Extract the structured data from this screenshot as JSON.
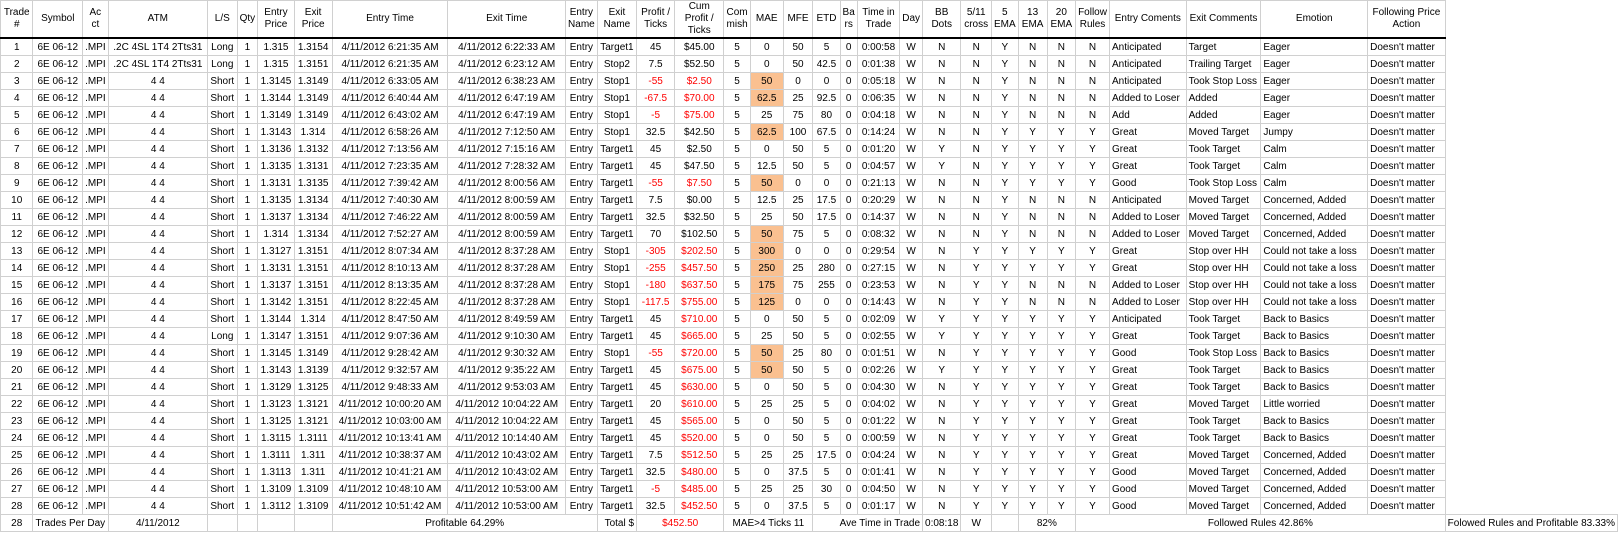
{
  "headers": [
    "Trade #",
    "Symbol",
    "Ac ct",
    "ATM",
    "L/S",
    "Qty",
    "Entry Price",
    "Exit Price",
    "Entry Time",
    "Exit Time",
    "Entry Name",
    "Exit Name",
    "Profit / Ticks",
    "Cum Profit / Ticks",
    "Com mish",
    "MAE",
    "MFE",
    "ETD",
    "Ba rs",
    "Time in Trade",
    "Day",
    "BB Dots",
    "5/11 cross",
    "5 EMA",
    "13 EMA",
    "20 EMA",
    "Follow Rules",
    "Entry Coments",
    "Exit Comments",
    "Emotion",
    "Following Price Action"
  ],
  "rows": [
    [
      "1",
      "6E 06-12",
      ".MPI",
      ".2C 4SL 1T4 2Tts31",
      "Long",
      "1",
      "1.315",
      "1.3154",
      "4/11/2012 6:21:35 AM",
      "4/11/2012 6:22:33 AM",
      "Entry",
      "Target1",
      "45",
      "$45.00",
      "5",
      "0",
      "50",
      "5",
      "0",
      "0:00:58",
      "W",
      "N",
      "N",
      "Y",
      "N",
      "N",
      "N",
      "Anticipated",
      "Target",
      "Eager",
      "Doesn't matter"
    ],
    [
      "2",
      "6E 06-12",
      ".MPI",
      ".2C 4SL 1T4 2Tts31",
      "Long",
      "1",
      "1.315",
      "1.3151",
      "4/11/2012 6:21:35 AM",
      "4/11/2012 6:23:12 AM",
      "Entry",
      "Stop2",
      "7.5",
      "$52.50",
      "5",
      "0",
      "50",
      "42.5",
      "0",
      "0:01:38",
      "W",
      "N",
      "N",
      "Y",
      "N",
      "N",
      "N",
      "Anticipated",
      "Trailing Target",
      "Eager",
      "Doesn't matter"
    ],
    [
      "3",
      "6E 06-12",
      ".MPI",
      "4 4",
      "Short",
      "1",
      "1.3145",
      "1.3149",
      "4/11/2012 6:33:05 AM",
      "4/11/2012 6:38:23 AM",
      "Entry",
      "Stop1",
      "-55",
      "$2.50",
      "5",
      "50",
      "0",
      "0",
      "0",
      "0:05:18",
      "W",
      "N",
      "N",
      "Y",
      "N",
      "N",
      "N",
      "Anticipated",
      "Took Stop Loss",
      "Eager",
      "Doesn't matter"
    ],
    [
      "4",
      "6E 06-12",
      ".MPI",
      "4 4",
      "Short",
      "1",
      "1.3144",
      "1.3149",
      "4/11/2012 6:40:44 AM",
      "4/11/2012 6:47:19 AM",
      "Entry",
      "Stop1",
      "-67.5",
      "$70.00",
      "5",
      "62.5",
      "25",
      "92.5",
      "0",
      "0:06:35",
      "W",
      "N",
      "N",
      "Y",
      "N",
      "N",
      "N",
      "Added to Loser",
      "Added",
      "Eager",
      "Doesn't matter"
    ],
    [
      "5",
      "6E 06-12",
      ".MPI",
      "4 4",
      "Short",
      "1",
      "1.3149",
      "1.3149",
      "4/11/2012 6:43:02 AM",
      "4/11/2012 6:47:19 AM",
      "Entry",
      "Stop1",
      "-5",
      "$75.00",
      "5",
      "25",
      "75",
      "80",
      "0",
      "0:04:18",
      "W",
      "N",
      "N",
      "Y",
      "N",
      "N",
      "N",
      "Add",
      "Added",
      "Eager",
      "Doesn't matter"
    ],
    [
      "6",
      "6E 06-12",
      ".MPI",
      "4 4",
      "Short",
      "1",
      "1.3143",
      "1.314",
      "4/11/2012 6:58:26 AM",
      "4/11/2012 7:12:50 AM",
      "Entry",
      "Stop1",
      "32.5",
      "$42.50",
      "5",
      "62.5",
      "100",
      "67.5",
      "0",
      "0:14:24",
      "W",
      "N",
      "N",
      "Y",
      "Y",
      "Y",
      "Y",
      "Great",
      "Moved Target",
      "Jumpy",
      "Doesn't matter"
    ],
    [
      "7",
      "6E 06-12",
      ".MPI",
      "4 4",
      "Short",
      "1",
      "1.3136",
      "1.3132",
      "4/11/2012 7:13:56 AM",
      "4/11/2012 7:15:16 AM",
      "Entry",
      "Target1",
      "45",
      "$2.50",
      "5",
      "0",
      "50",
      "5",
      "0",
      "0:01:20",
      "W",
      "Y",
      "N",
      "Y",
      "Y",
      "Y",
      "Y",
      "Great",
      "Took Target",
      "Calm",
      "Doesn't matter"
    ],
    [
      "8",
      "6E 06-12",
      ".MPI",
      "4 4",
      "Short",
      "1",
      "1.3135",
      "1.3131",
      "4/11/2012 7:23:35 AM",
      "4/11/2012 7:28:32 AM",
      "Entry",
      "Target1",
      "45",
      "$47.50",
      "5",
      "12.5",
      "50",
      "5",
      "0",
      "0:04:57",
      "W",
      "Y",
      "N",
      "Y",
      "Y",
      "Y",
      "Y",
      "Great",
      "Took Target",
      "Calm",
      "Doesn't matter"
    ],
    [
      "9",
      "6E 06-12",
      ".MPI",
      "4 4",
      "Short",
      "1",
      "1.3131",
      "1.3135",
      "4/11/2012 7:39:42 AM",
      "4/11/2012 8:00:56 AM",
      "Entry",
      "Target1",
      "-55",
      "$7.50",
      "5",
      "50",
      "0",
      "0",
      "0",
      "0:21:13",
      "W",
      "N",
      "N",
      "Y",
      "Y",
      "Y",
      "Y",
      "Good",
      "Took Stop Loss",
      "Calm",
      "Doesn't matter"
    ],
    [
      "10",
      "6E 06-12",
      ".MPI",
      "4 4",
      "Short",
      "1",
      "1.3135",
      "1.3134",
      "4/11/2012 7:40:30 AM",
      "4/11/2012 8:00:59 AM",
      "Entry",
      "Target1",
      "7.5",
      "$0.00",
      "5",
      "12.5",
      "25",
      "17.5",
      "0",
      "0:20:29",
      "W",
      "N",
      "N",
      "Y",
      "N",
      "N",
      "N",
      "Anticipated",
      "Moved Target",
      "Concerned, Added",
      "Doesn't matter"
    ],
    [
      "11",
      "6E 06-12",
      ".MPI",
      "4 4",
      "Short",
      "1",
      "1.3137",
      "1.3134",
      "4/11/2012 7:46:22 AM",
      "4/11/2012 8:00:59 AM",
      "Entry",
      "Target1",
      "32.5",
      "$32.50",
      "5",
      "25",
      "50",
      "17.5",
      "0",
      "0:14:37",
      "W",
      "N",
      "N",
      "Y",
      "N",
      "N",
      "N",
      "Added to Loser",
      "Moved Target",
      "Concerned, Added",
      "Doesn't matter"
    ],
    [
      "12",
      "6E 06-12",
      ".MPI",
      "4 4",
      "Short",
      "1",
      "1.314",
      "1.3134",
      "4/11/2012 7:52:27 AM",
      "4/11/2012 8:00:59 AM",
      "Entry",
      "Target1",
      "70",
      "$102.50",
      "5",
      "50",
      "75",
      "5",
      "0",
      "0:08:32",
      "W",
      "N",
      "N",
      "Y",
      "N",
      "N",
      "N",
      "Added to Loser",
      "Moved Target",
      "Concerned, Added",
      "Doesn't matter"
    ],
    [
      "13",
      "6E 06-12",
      ".MPI",
      "4 4",
      "Short",
      "1",
      "1.3127",
      "1.3151",
      "4/11/2012 8:07:34 AM",
      "4/11/2012 8:37:28 AM",
      "Entry",
      "Stop1",
      "-305",
      "$202.50",
      "5",
      "300",
      "0",
      "0",
      "0",
      "0:29:54",
      "W",
      "N",
      "Y",
      "Y",
      "Y",
      "Y",
      "Y",
      "Great",
      "Stop over HH",
      "Could not take a loss",
      "Doesn't matter"
    ],
    [
      "14",
      "6E 06-12",
      ".MPI",
      "4 4",
      "Short",
      "1",
      "1.3131",
      "1.3151",
      "4/11/2012 8:10:13 AM",
      "4/11/2012 8:37:28 AM",
      "Entry",
      "Stop1",
      "-255",
      "$457.50",
      "5",
      "250",
      "25",
      "280",
      "0",
      "0:27:15",
      "W",
      "N",
      "Y",
      "Y",
      "Y",
      "Y",
      "Y",
      "Great",
      "Stop over HH",
      "Could not take a loss",
      "Doesn't matter"
    ],
    [
      "15",
      "6E 06-12",
      ".MPI",
      "4 4",
      "Short",
      "1",
      "1.3137",
      "1.3151",
      "4/11/2012 8:13:35 AM",
      "4/11/2012 8:37:28 AM",
      "Entry",
      "Stop1",
      "-180",
      "$637.50",
      "5",
      "175",
      "75",
      "255",
      "0",
      "0:23:53",
      "W",
      "N",
      "Y",
      "Y",
      "N",
      "N",
      "N",
      "Added to Loser",
      "Stop over HH",
      "Could not take a loss",
      "Doesn't matter"
    ],
    [
      "16",
      "6E 06-12",
      ".MPI",
      "4 4",
      "Short",
      "1",
      "1.3142",
      "1.3151",
      "4/11/2012 8:22:45 AM",
      "4/11/2012 8:37:28 AM",
      "Entry",
      "Stop1",
      "-117.5",
      "$755.00",
      "5",
      "125",
      "0",
      "0",
      "0",
      "0:14:43",
      "W",
      "N",
      "Y",
      "Y",
      "N",
      "N",
      "N",
      "Added to Loser",
      "Stop over HH",
      "Could not take a loss",
      "Doesn't matter"
    ],
    [
      "17",
      "6E 06-12",
      ".MPI",
      "4 4",
      "Short",
      "1",
      "1.3144",
      "1.314",
      "4/11/2012 8:47:50 AM",
      "4/11/2012 8:49:59 AM",
      "Entry",
      "Target1",
      "45",
      "$710.00",
      "5",
      "0",
      "50",
      "5",
      "0",
      "0:02:09",
      "W",
      "Y",
      "Y",
      "Y",
      "Y",
      "Y",
      "Y",
      "Anticipated",
      "Took Target",
      "Back to Basics",
      "Doesn't matter"
    ],
    [
      "18",
      "6E 06-12",
      ".MPI",
      "4 4",
      "Long",
      "1",
      "1.3147",
      "1.3151",
      "4/11/2012 9:07:36 AM",
      "4/11/2012 9:10:30 AM",
      "Entry",
      "Target1",
      "45",
      "$665.00",
      "5",
      "25",
      "50",
      "5",
      "0",
      "0:02:55",
      "W",
      "Y",
      "Y",
      "Y",
      "Y",
      "Y",
      "Y",
      "Great",
      "Took Target",
      "Back to Basics",
      "Doesn't matter"
    ],
    [
      "19",
      "6E 06-12",
      ".MPI",
      "4 4",
      "Short",
      "1",
      "1.3145",
      "1.3149",
      "4/11/2012 9:28:42 AM",
      "4/11/2012 9:30:32 AM",
      "Entry",
      "Stop1",
      "-55",
      "$720.00",
      "5",
      "50",
      "25",
      "80",
      "0",
      "0:01:51",
      "W",
      "N",
      "Y",
      "Y",
      "Y",
      "Y",
      "Y",
      "Good",
      "Took Stop Loss",
      "Back to Basics",
      "Doesn't matter"
    ],
    [
      "20",
      "6E 06-12",
      ".MPI",
      "4 4",
      "Short",
      "1",
      "1.3143",
      "1.3139",
      "4/11/2012 9:32:57 AM",
      "4/11/2012 9:35:22 AM",
      "Entry",
      "Target1",
      "45",
      "$675.00",
      "5",
      "50",
      "50",
      "5",
      "0",
      "0:02:26",
      "W",
      "Y",
      "Y",
      "Y",
      "Y",
      "Y",
      "Y",
      "Great",
      "Took Target",
      "Back to Basics",
      "Doesn't matter"
    ],
    [
      "21",
      "6E 06-12",
      ".MPI",
      "4 4",
      "Short",
      "1",
      "1.3129",
      "1.3125",
      "4/11/2012 9:48:33 AM",
      "4/11/2012 9:53:03 AM",
      "Entry",
      "Target1",
      "45",
      "$630.00",
      "5",
      "0",
      "50",
      "5",
      "0",
      "0:04:30",
      "W",
      "N",
      "Y",
      "Y",
      "Y",
      "Y",
      "Y",
      "Great",
      "Took Target",
      "Back to Basics",
      "Doesn't matter"
    ],
    [
      "22",
      "6E 06-12",
      ".MPI",
      "4 4",
      "Short",
      "1",
      "1.3123",
      "1.3121",
      "4/11/2012 10:00:20 AM",
      "4/11/2012 10:04:22 AM",
      "Entry",
      "Target1",
      "20",
      "$610.00",
      "5",
      "25",
      "25",
      "5",
      "0",
      "0:04:02",
      "W",
      "N",
      "Y",
      "Y",
      "Y",
      "Y",
      "Y",
      "Great",
      "Moved Target",
      "Little worried",
      "Doesn't matter"
    ],
    [
      "23",
      "6E 06-12",
      ".MPI",
      "4 4",
      "Short",
      "1",
      "1.3125",
      "1.3121",
      "4/11/2012 10:03:00 AM",
      "4/11/2012 10:04:22 AM",
      "Entry",
      "Target1",
      "45",
      "$565.00",
      "5",
      "0",
      "50",
      "5",
      "0",
      "0:01:22",
      "W",
      "N",
      "Y",
      "Y",
      "Y",
      "Y",
      "Y",
      "Great",
      "Took Target",
      "Back to Basics",
      "Doesn't matter"
    ],
    [
      "24",
      "6E 06-12",
      ".MPI",
      "4 4",
      "Short",
      "1",
      "1.3115",
      "1.3111",
      "4/11/2012 10:13:41 AM",
      "4/11/2012 10:14:40 AM",
      "Entry",
      "Target1",
      "45",
      "$520.00",
      "5",
      "0",
      "50",
      "5",
      "0",
      "0:00:59",
      "W",
      "N",
      "Y",
      "Y",
      "Y",
      "Y",
      "Y",
      "Great",
      "Took Target",
      "Back to Basics",
      "Doesn't matter"
    ],
    [
      "25",
      "6E 06-12",
      ".MPI",
      "4 4",
      "Short",
      "1",
      "1.3111",
      "1.311",
      "4/11/2012 10:38:37 AM",
      "4/11/2012 10:43:02 AM",
      "Entry",
      "Target1",
      "7.5",
      "$512.50",
      "5",
      "25",
      "25",
      "17.5",
      "0",
      "0:04:24",
      "W",
      "N",
      "Y",
      "Y",
      "Y",
      "Y",
      "Y",
      "Great",
      "Moved Target",
      "Concerned, Added",
      "Doesn't matter"
    ],
    [
      "26",
      "6E 06-12",
      ".MPI",
      "4 4",
      "Short",
      "1",
      "1.3113",
      "1.311",
      "4/11/2012 10:41:21 AM",
      "4/11/2012 10:43:02 AM",
      "Entry",
      "Target1",
      "32.5",
      "$480.00",
      "5",
      "0",
      "37.5",
      "5",
      "0",
      "0:01:41",
      "W",
      "N",
      "Y",
      "Y",
      "Y",
      "Y",
      "Y",
      "Good",
      "Moved Target",
      "Concerned, Added",
      "Doesn't matter"
    ],
    [
      "27",
      "6E 06-12",
      ".MPI",
      "4 4",
      "Short",
      "1",
      "1.3109",
      "1.3109",
      "4/11/2012 10:48:10 AM",
      "4/11/2012 10:53:00 AM",
      "Entry",
      "Target1",
      "-5",
      "$485.00",
      "5",
      "25",
      "25",
      "30",
      "0",
      "0:04:50",
      "W",
      "N",
      "Y",
      "Y",
      "Y",
      "Y",
      "Y",
      "Good",
      "Moved Target",
      "Concerned, Added",
      "Doesn't matter"
    ],
    [
      "28",
      "6E 06-12",
      ".MPI",
      "4 4",
      "Short",
      "1",
      "1.3112",
      "1.3109",
      "4/11/2012 10:51:42 AM",
      "4/11/2012 10:53:00 AM",
      "Entry",
      "Target1",
      "32.5",
      "$452.50",
      "5",
      "0",
      "37.5",
      "5",
      "0",
      "0:01:17",
      "W",
      "N",
      "Y",
      "Y",
      "Y",
      "Y",
      "Y",
      "Good",
      "Moved Target",
      "Concerned, Added",
      "Doesn't matter"
    ]
  ],
  "summary": {
    "count": "28",
    "trades_per_day_label": "Trades Per Day",
    "date": "4/11/2012",
    "profitable": "Profitable  64.29%",
    "total_label": "Total $",
    "total_value": "$452.50",
    "mae_label": "MAE>4 Ticks  11",
    "ave_time_label": "Ave Time in Trade",
    "ave_time_value": "0:08:18",
    "ave_day": "W",
    "cross_pct": "82%",
    "followed_rules": "Followed Rules  42.86%",
    "followed_profitable": "Folowed Rules and Profitable  83.33%"
  },
  "colors": {
    "negative": "#ff0000",
    "mae_highlight": "#fac090",
    "yellow": "#ffff00",
    "green": "#c4f0c4",
    "blue": "#bde8f7"
  }
}
